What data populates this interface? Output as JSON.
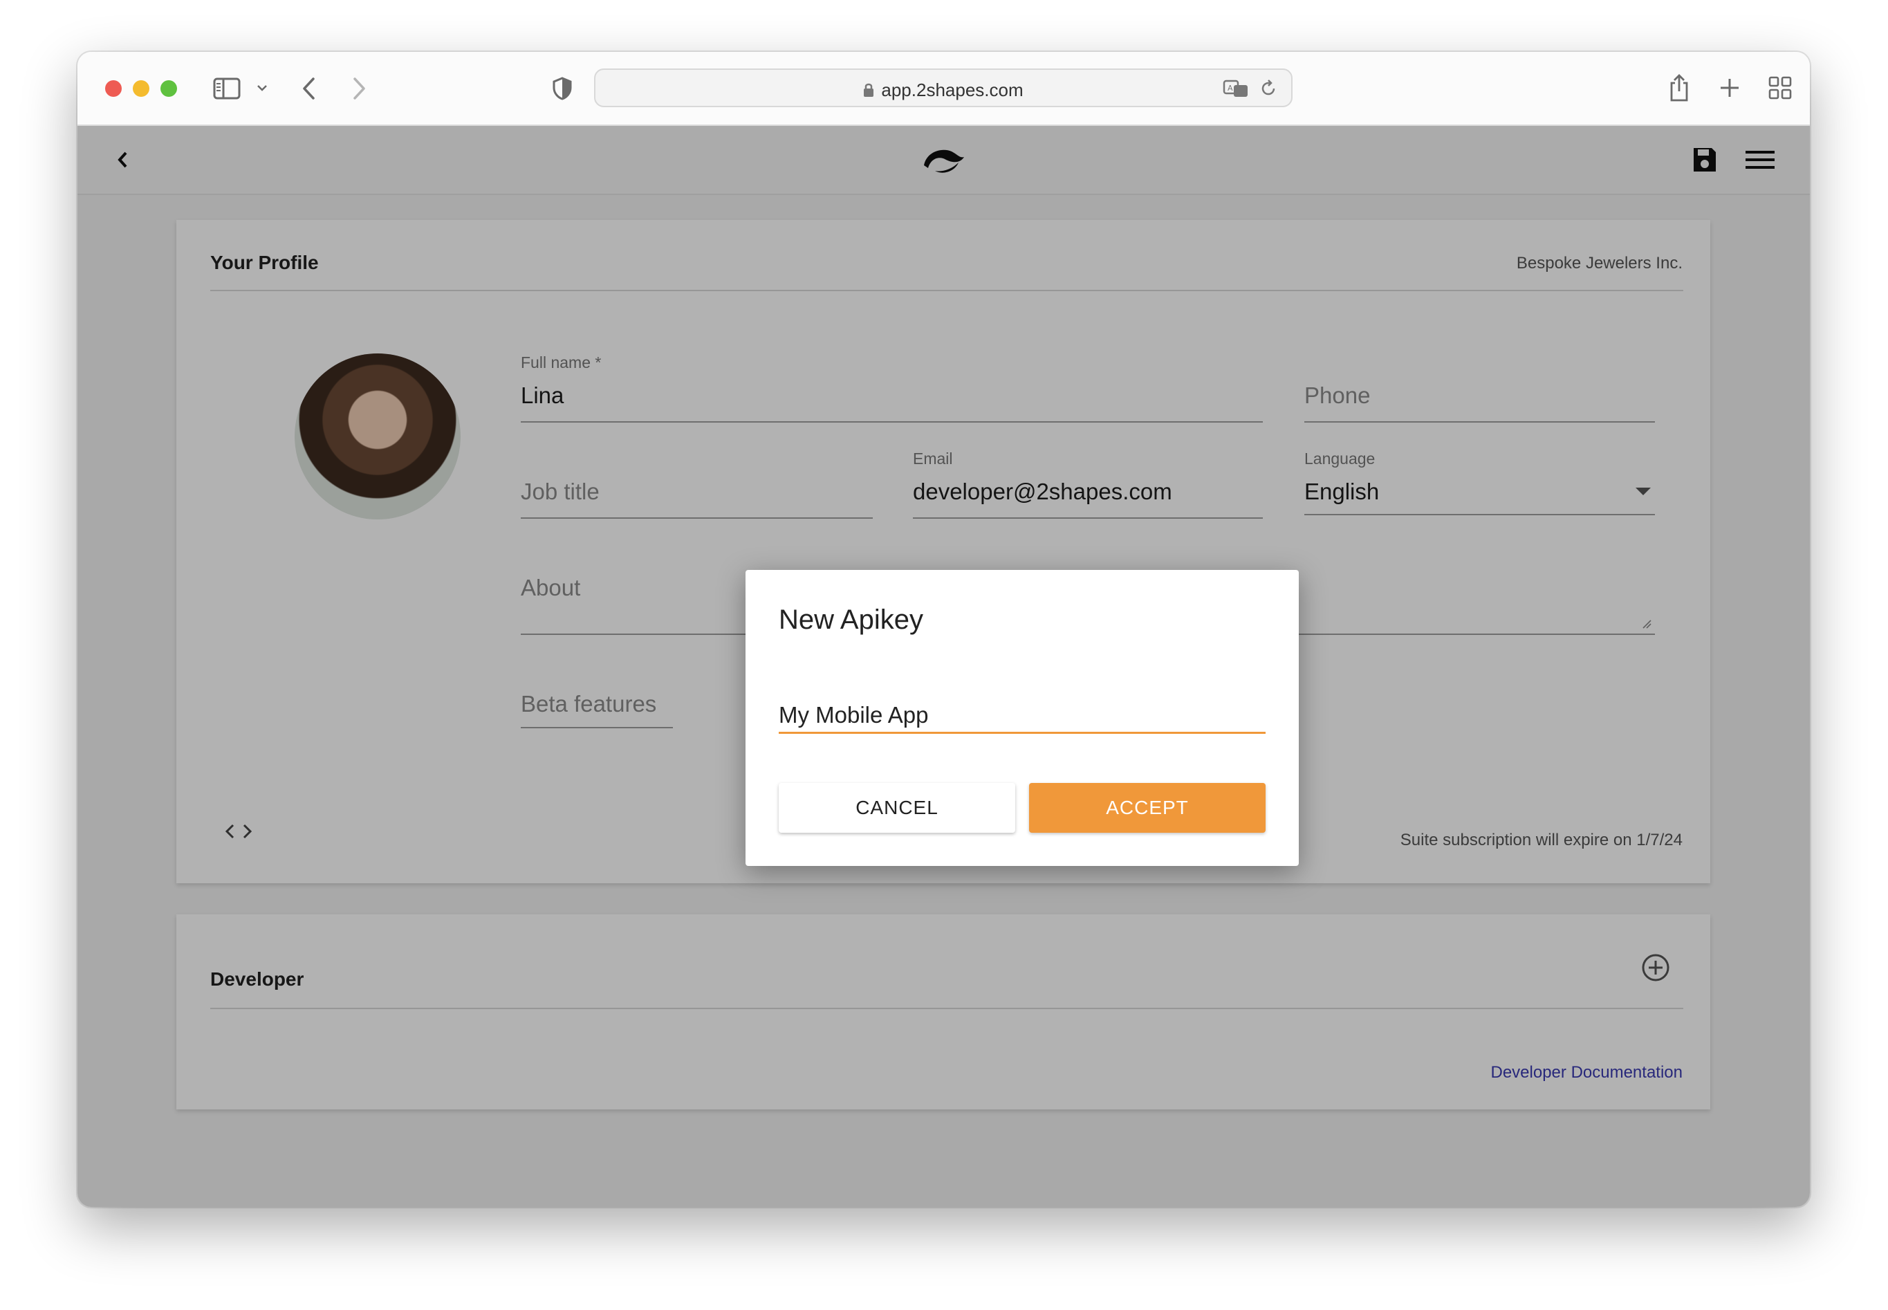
{
  "browser": {
    "url": "app.2shapes.com"
  },
  "profile": {
    "title": "Your Profile",
    "company": "Bespoke Jewelers Inc.",
    "full_name_label": "Full name *",
    "full_name_value": "Lina",
    "phone_placeholder": "Phone",
    "job_title_placeholder": "Job title",
    "email_label": "Email",
    "email_value": "developer@2shapes.com",
    "language_label": "Language",
    "language_value": "English",
    "about_placeholder": "About",
    "beta_placeholder": "Beta features",
    "subscription_text": "Suite subscription will expire on 1/7/24"
  },
  "developer": {
    "title": "Developer",
    "docs_link": "Developer Documentation"
  },
  "dialog": {
    "title": "New Apikey",
    "input_value": "My Mobile App",
    "cancel_label": "CANCEL",
    "accept_label": "ACCEPT"
  },
  "colors": {
    "accent": "#f0983a",
    "link": "#3a3ab0"
  }
}
